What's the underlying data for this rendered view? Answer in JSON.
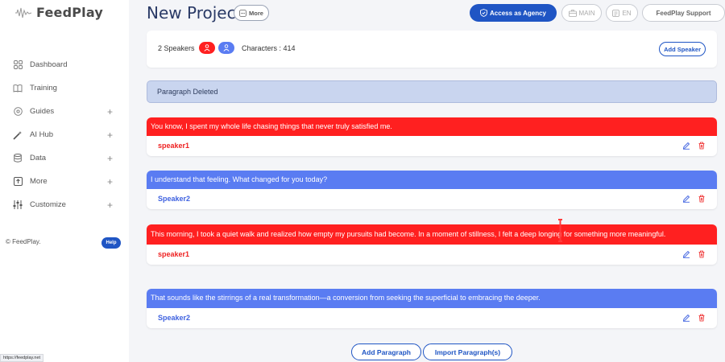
{
  "app": {
    "name": "FeedPlay",
    "copyright": "© FeedPlay.",
    "help_label": "Help",
    "status_url": "https://feedplay.net"
  },
  "sidebar": {
    "items": [
      {
        "label": "Dashboard",
        "icon": "grid-icon",
        "expandable": false
      },
      {
        "label": "Training",
        "icon": "book-icon",
        "expandable": false
      },
      {
        "label": "Guides",
        "icon": "compass-icon",
        "expandable": true
      },
      {
        "label": "AI Hub",
        "icon": "magic-wand-icon",
        "expandable": true
      },
      {
        "label": "Data",
        "icon": "database-icon",
        "expandable": true
      },
      {
        "label": "More",
        "icon": "upload-box-icon",
        "expandable": true
      },
      {
        "label": "Customize",
        "icon": "sliders-icon",
        "expandable": true
      }
    ],
    "plus_symbol": "+"
  },
  "header": {
    "title": "New Project",
    "more_label": "More",
    "agency_label": "Access as Agency",
    "main_label": "MAIN",
    "lang_label": "EN",
    "support_label": "FeedPlay Support"
  },
  "speakers": {
    "count_label": "2 Speakers",
    "characters_label": "Characters : 414",
    "add_label": "Add Speaker"
  },
  "notice": {
    "text": "Paragraph Deleted"
  },
  "paragraphs": [
    {
      "text": "You know, I spent my whole life chasing things that never truly satisfied me.",
      "speaker": "speaker1",
      "color": "#ff2020"
    },
    {
      "text": "I understand that feeling. What changed for you today?",
      "speaker": "Speaker2",
      "color": "#5a7cf2"
    },
    {
      "text": "This morning, I took a quiet walk and realized how empty my pursuits had become. In a moment of stillness, I felt a deep longing for something more meaningful.",
      "speaker": "speaker1",
      "color": "#ff2020"
    },
    {
      "text": "That sounds like the stirrings of a real transformation—a conversion from seeking the superficial to embracing the deeper.",
      "speaker": "Speaker2",
      "color": "#5a7cf2"
    }
  ],
  "actions": {
    "add_paragraph": "Add Paragraph",
    "import_paragraphs": "Import Paragraph(s)"
  },
  "colors": {
    "brand_blue": "#1f55c4",
    "speaker1_red": "#ff2020",
    "speaker2_blue": "#5a7cf2"
  }
}
